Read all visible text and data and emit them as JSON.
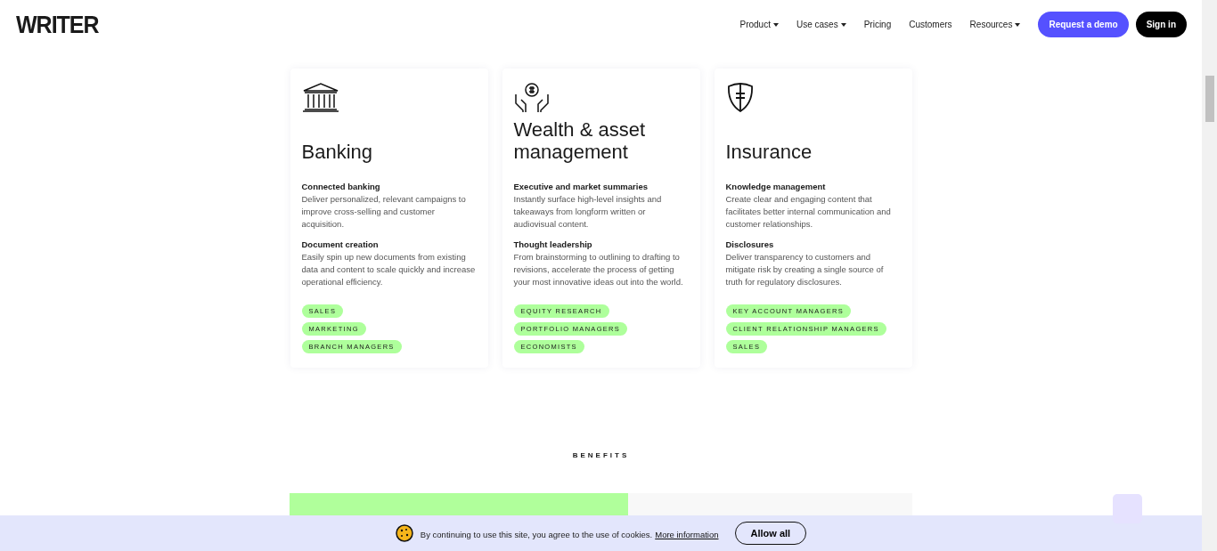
{
  "header": {
    "logo": "WRITER",
    "nav": [
      {
        "label": "Product",
        "dropdown": true
      },
      {
        "label": "Use cases",
        "dropdown": true
      },
      {
        "label": "Pricing",
        "dropdown": false
      },
      {
        "label": "Customers",
        "dropdown": false
      },
      {
        "label": "Resources",
        "dropdown": true
      }
    ],
    "demo_button": "Request a demo",
    "signin_button": "Sign in"
  },
  "cards": [
    {
      "kind": "bank",
      "title": "Banking",
      "sections": [
        {
          "heading": "Connected banking",
          "text": "Deliver personalized, relevant campaigns to improve cross-selling and customer acquisition."
        },
        {
          "heading": "Document creation",
          "text": "Easily spin up new documents from existing data and content to scale quickly and increase operational efficiency."
        }
      ],
      "tags": [
        "SALES",
        "MARKETING",
        "BRANCH MANAGERS"
      ]
    },
    {
      "kind": "hands",
      "title": "Wealth & asset management",
      "sections": [
        {
          "heading": "Executive and market summaries",
          "text": "Instantly surface high-level insights and takeaways from longform written or audiovisual content."
        },
        {
          "heading": "Thought leadership",
          "text": "From brainstorming to outlining to drafting to revisions, accelerate the process of getting your most innovative ideas out into the world."
        }
      ],
      "tags": [
        "EQUITY RESEARCH",
        "PORTFOLIO MANAGERS",
        "ECONOMISTS"
      ]
    },
    {
      "kind": "shield",
      "title": "Insurance",
      "sections": [
        {
          "heading": "Knowledge management",
          "text": "Create clear and engaging content that facilitates better internal communication and customer relationships."
        },
        {
          "heading": "Disclosures",
          "text": "Deliver transparency to customers and mitigate risk by creating a single source of truth for regulatory disclosures."
        }
      ],
      "tags": [
        "KEY ACCOUNT MANAGERS",
        "CLIENT RELATIONSHIP MANAGERS",
        "SALES"
      ]
    }
  ],
  "benefits_label": "BENEFITS",
  "cookie_bar": {
    "text": "By continuing to use this site, you agree to the use of cookies.",
    "link": "More information",
    "button": "Allow all"
  }
}
